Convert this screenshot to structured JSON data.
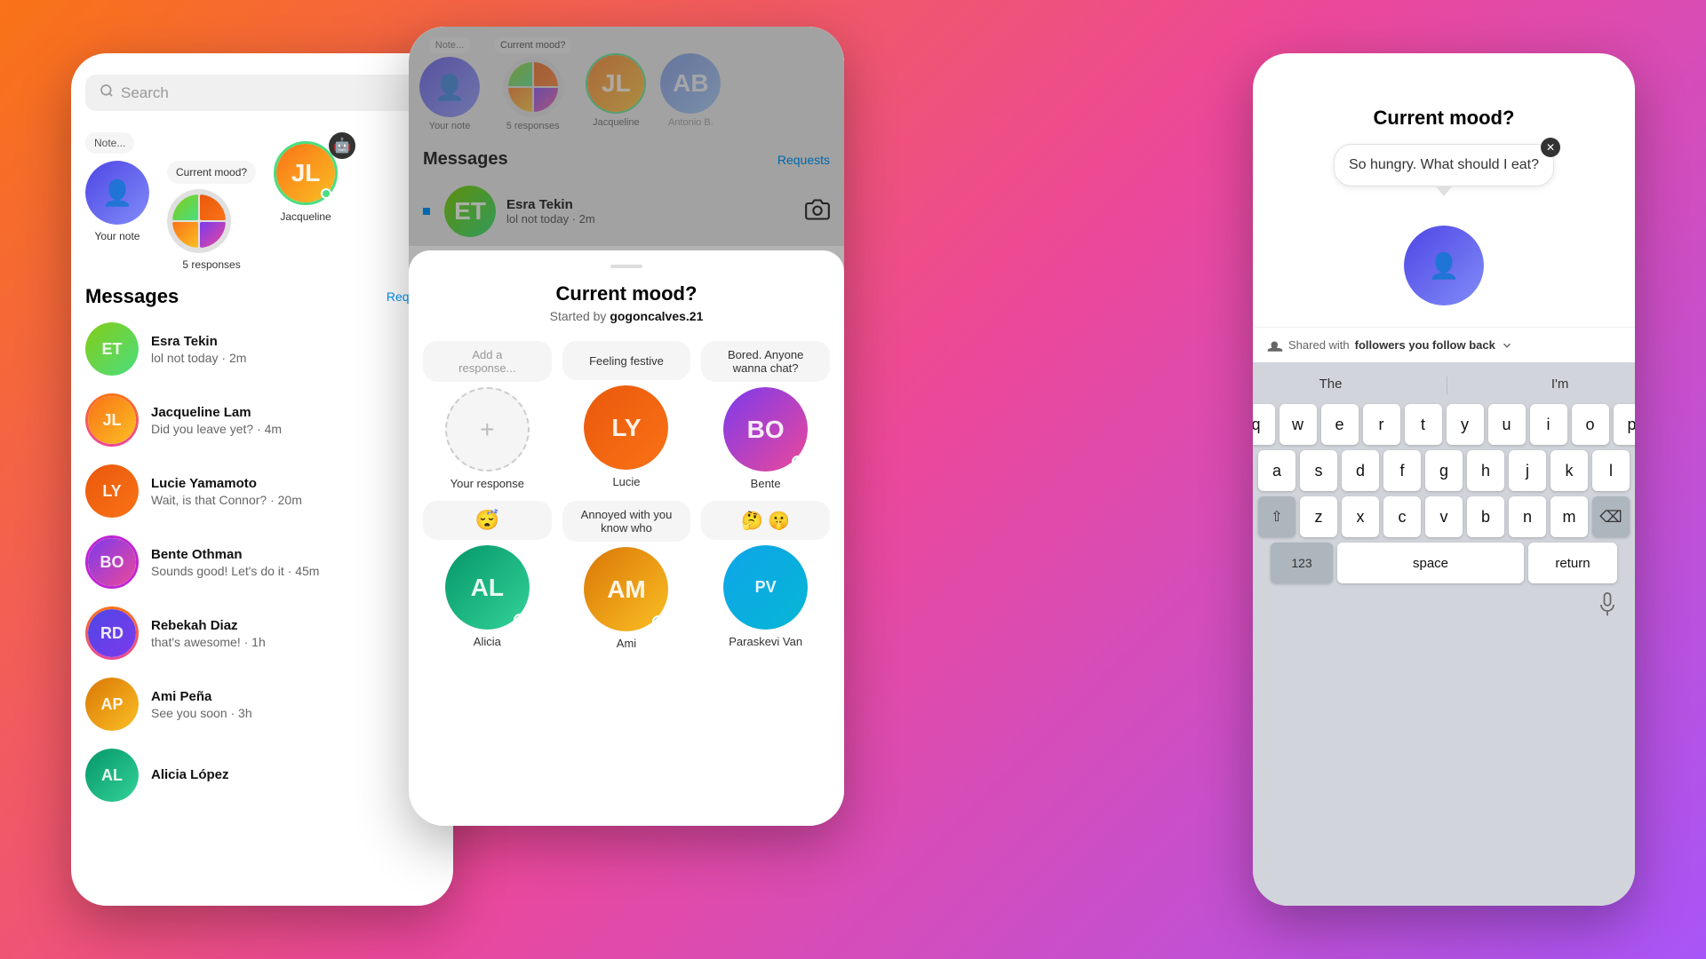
{
  "leftPhone": {
    "search": {
      "placeholder": "Search"
    },
    "stories": [
      {
        "id": "your-note",
        "label": "Your note",
        "bubble": "Note...",
        "hasBubble": true,
        "avatar": "user",
        "emoji": "👤"
      },
      {
        "id": "five-responses",
        "label": "5 responses",
        "bubble": "Current mood?",
        "hasBubble": true,
        "avatar": "multi",
        "emoji": ""
      },
      {
        "id": "jacqueline",
        "label": "Jacqueline",
        "bubble": "",
        "hasBubble": false,
        "avatar": "jacqueline",
        "hasGreenDot": true,
        "emoji": "🤖"
      }
    ],
    "messagesTitle": "Messages",
    "requestsLabel": "Requests",
    "messages": [
      {
        "id": "esra",
        "name": "Esra Tekin",
        "preview": "lol not today · 2m",
        "avatar": "esra",
        "hasUnread": true,
        "initials": "ET"
      },
      {
        "id": "jacqueline",
        "name": "Jacqueline Lam",
        "preview": "Did you leave yet? · 4m",
        "avatar": "jacqueline",
        "hasRingGradient": true,
        "initials": "JL"
      },
      {
        "id": "lucie",
        "name": "Lucie Yamamoto",
        "preview": "Wait, is that Connor? · 20m",
        "avatar": "lucie",
        "initials": "LY"
      },
      {
        "id": "bente",
        "name": "Bente Othman",
        "preview": "Sounds good! Let's do it · 45m",
        "avatar": "bente",
        "hasRingPurple": true,
        "initials": "BO"
      },
      {
        "id": "rebekah",
        "name": "Rebekah Diaz",
        "preview": "that's awesome! · 1h",
        "avatar": "rebekah",
        "hasRingGradient": true,
        "initials": "RD"
      },
      {
        "id": "ami",
        "name": "Ami Peña",
        "preview": "See you soon · 3h",
        "avatar": "ami",
        "initials": "AP"
      },
      {
        "id": "alicia",
        "name": "Alicia López",
        "preview": "",
        "avatar": "alicia",
        "initials": "AL"
      }
    ]
  },
  "middlePhone": {
    "stories": [
      {
        "id": "note",
        "label": "Note...",
        "avatar": "user"
      },
      {
        "id": "current-mood",
        "label": "Current mood?",
        "avatar": "multi"
      },
      {
        "id": "jacqueline-mid",
        "label": "Jacqueline",
        "avatar": "jacqueline"
      },
      {
        "id": "antonio",
        "label": "Antonio B.",
        "avatar": "antonio"
      }
    ],
    "messagesTitle": "Messages",
    "requestsLabel": "Requests",
    "messages": [
      {
        "id": "esra-mid",
        "name": "Esra Tekin",
        "preview": "lol not today · 2m",
        "avatar": "esra",
        "hasUnread": true,
        "initials": "ET"
      }
    ],
    "modal": {
      "title": "Current mood?",
      "subtitle": "Started by",
      "subtitleUser": "gogoncalves.21",
      "moodCards": [
        {
          "id": "add",
          "bubble": "Add a response...",
          "isAdd": true,
          "name": "Your response",
          "avatar": "user",
          "emoji": "👤",
          "hasEmoji": false
        },
        {
          "id": "feeling-festive",
          "bubble": "Feeling festive",
          "name": "Lucie",
          "avatar": "lucie",
          "emoji": "",
          "hasEmoji": false
        },
        {
          "id": "bored",
          "bubble": "Bored. Anyone wanna chat?",
          "name": "Bente",
          "avatar": "bente",
          "hasGreenDot": true,
          "emoji": "",
          "hasEmoji": false
        },
        {
          "id": "sleepy",
          "bubble": "😴",
          "name": "Alicia",
          "avatar": "alicia",
          "emoji": "😴",
          "hasEmoji": true,
          "hasGreenDot": true
        },
        {
          "id": "annoyed",
          "bubble": "Annoyed with you know who",
          "name": "Ami",
          "avatar": "ami",
          "hasGreenDot": true,
          "emoji": "",
          "hasEmoji": false
        },
        {
          "id": "thinking",
          "bubble": "🤔 🤫",
          "name": "Paraskevi Van",
          "avatar": "paraskevi",
          "emoji": "🤔",
          "hasEmoji": true
        }
      ]
    }
  },
  "rightPhone": {
    "moodTitle": "Current mood?",
    "thoughtText": "So hungry. What should I eat?",
    "avatar": "user",
    "sharedWith": "Shared with",
    "followersText": "followers you follow back",
    "keyboard": {
      "suggestions": [
        "The",
        "I'm"
      ],
      "rows": [
        [
          "q",
          "w",
          "e",
          "r",
          "t",
          "y",
          "u",
          "i",
          "o",
          "p"
        ],
        [
          "a",
          "s",
          "d",
          "f",
          "g",
          "h",
          "j",
          "k",
          "l"
        ],
        [
          "⇧",
          "z",
          "x",
          "c",
          "v",
          "b",
          "n",
          "m",
          "⌫"
        ],
        [
          "123",
          "space",
          "return"
        ]
      ]
    }
  }
}
